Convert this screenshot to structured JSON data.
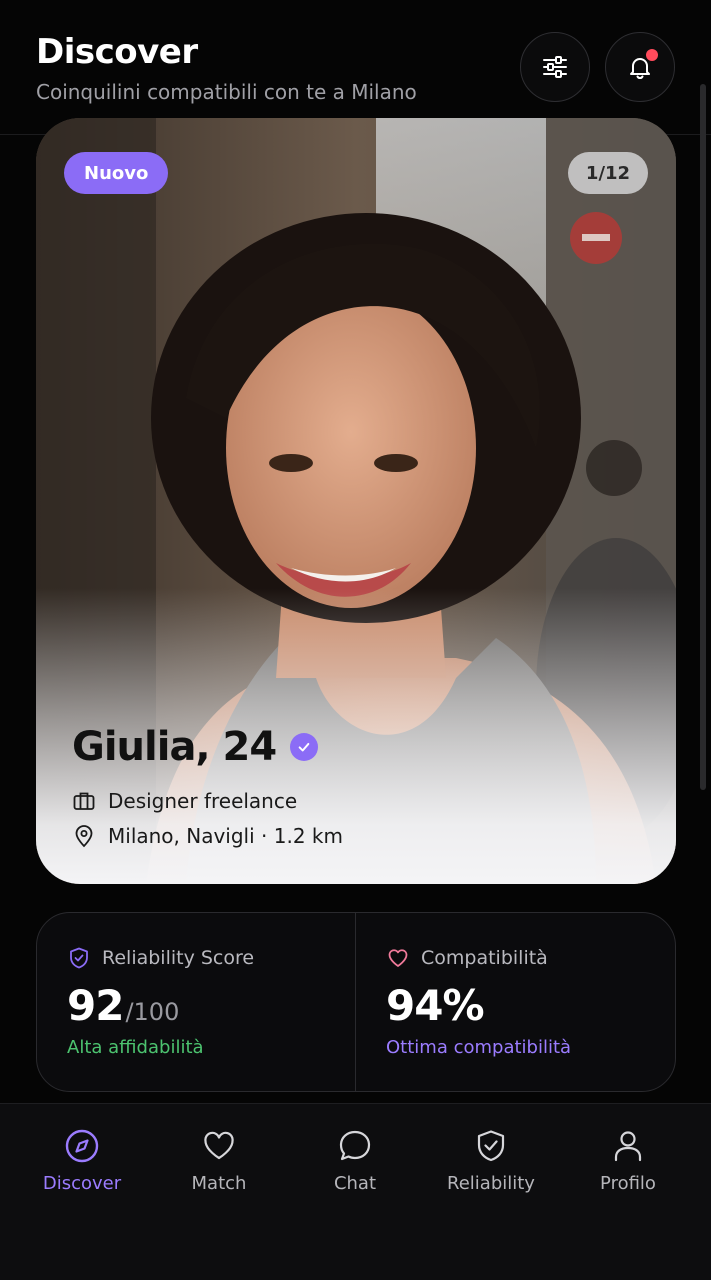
{
  "header": {
    "title": "Discover",
    "subtitle": "Coinquilini compatibili con te a Milano",
    "filter_icon": "sliders-icon",
    "notifications_icon": "bell-icon",
    "has_notification": true
  },
  "profile_card": {
    "badge": "Nuovo",
    "counter": "1/12",
    "name_age": "Giulia, 24",
    "verified": true,
    "occupation": "Designer freelance",
    "location": "Milano, Navigli · 1.2 km",
    "occupation_icon": "briefcase-icon",
    "location_icon": "map-pin-icon"
  },
  "stats": {
    "reliability": {
      "label": "Reliability Score",
      "value": "92",
      "max": "/100",
      "note": "Alta affidabilità",
      "icon": "shield-check-icon"
    },
    "compatibility": {
      "label": "Compatibilità",
      "value": "94%",
      "note": "Ottima compatibilità",
      "icon": "heart-icon"
    }
  },
  "nav": {
    "items": [
      {
        "label": "Discover",
        "icon": "compass-icon",
        "active": true
      },
      {
        "label": "Match",
        "icon": "heart-icon",
        "active": false
      },
      {
        "label": "Chat",
        "icon": "chat-bubble-icon",
        "active": false
      },
      {
        "label": "Reliability",
        "icon": "shield-check-icon",
        "active": false
      },
      {
        "label": "Profilo",
        "icon": "user-icon",
        "active": false
      }
    ]
  },
  "colors": {
    "accent": "#8b6cf6",
    "accent_text": "#9b7cff",
    "success": "#4cc36f",
    "notification": "#ff4b5c",
    "heart": "#f07a9a",
    "background": "#050505"
  }
}
